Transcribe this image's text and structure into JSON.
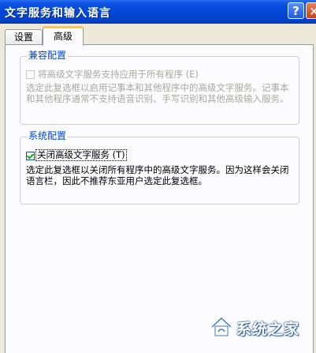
{
  "window": {
    "title": "文字服务和输入语言",
    "help_label": "?",
    "close_label": "×"
  },
  "tabs": [
    {
      "label": "设置",
      "active": false
    },
    {
      "label": "高级",
      "active": true
    }
  ],
  "compat_group": {
    "legend": "兼容配置",
    "checkbox_label": "将高级文字服务支持应用于所有程序 (E)",
    "checked": false,
    "enabled": false,
    "description": "选定此复选框以启用记事本和其他程序中的高级文字服务。记事本和其他程序通常不支持语音识别、手写识别和其他高级输入服务。"
  },
  "system_group": {
    "legend": "系统配置",
    "checkbox_label": "关闭高级文字服务 (T)",
    "checked": true,
    "enabled": true,
    "description": "选定此复选框以关闭所有程序中的高级文字服务。因为这样会关闭语言栏，因此不推荐东亚用户选定此复选框。"
  },
  "watermark": {
    "text": "系统之家"
  },
  "colors": {
    "titlebar": "#0346d6",
    "legend_text": "#0046d5",
    "disabled_text": "#a9a89f",
    "active_tab_accent": "#ffc83c"
  }
}
